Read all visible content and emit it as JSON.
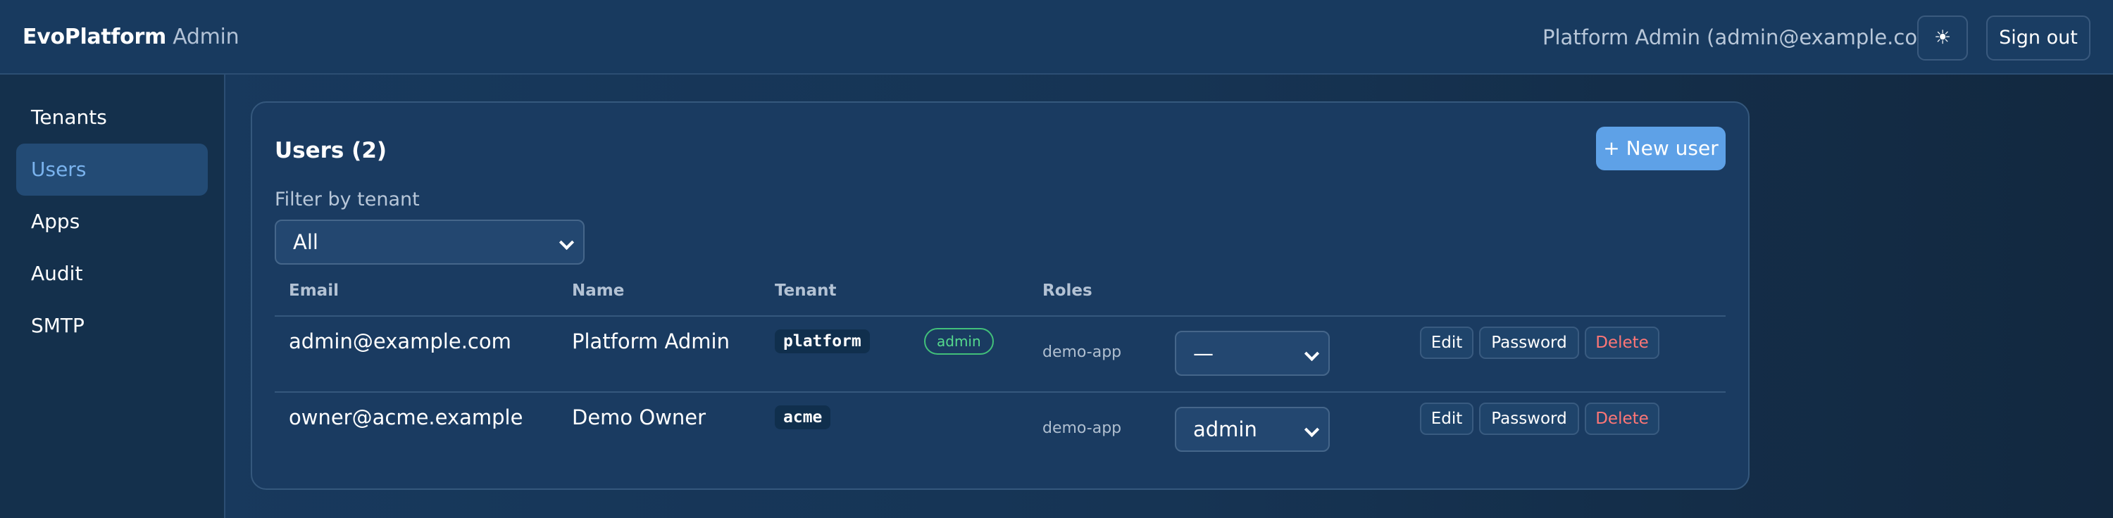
{
  "header": {
    "brand_primary": "EvoPlatform",
    "brand_secondary": "Admin",
    "current_user": "Platform Admin (admin@example.com)",
    "theme_icon": "sun-icon",
    "theme_glyph": "☀",
    "sign_out_label": "Sign out"
  },
  "sidebar": {
    "items": [
      {
        "label": "Tenants",
        "active": false
      },
      {
        "label": "Users",
        "active": true
      },
      {
        "label": "Apps",
        "active": false
      },
      {
        "label": "Audit",
        "active": false
      },
      {
        "label": "SMTP",
        "active": false
      }
    ]
  },
  "main": {
    "title": "Users (2)",
    "new_user_label": "+ New user",
    "filter": {
      "label": "Filter by tenant",
      "selected": "All"
    },
    "table": {
      "columns": [
        "Email",
        "Name",
        "Tenant",
        "Roles"
      ],
      "rows": [
        {
          "email": "admin@example.com",
          "name": "Platform Admin",
          "tenant": "platform",
          "role_badge": "admin",
          "app": "demo-app",
          "role_select": "—",
          "actions": [
            "Edit",
            "Password",
            "Delete"
          ]
        },
        {
          "email": "owner@acme.example",
          "name": "Demo Owner",
          "tenant": "acme",
          "role_badge": "",
          "app": "demo-app",
          "role_select": "admin",
          "actions": [
            "Edit",
            "Password",
            "Delete"
          ]
        }
      ]
    }
  },
  "colors": {
    "accent": "#5ea1e7",
    "active_nav_text": "#7ab3ee",
    "success": "#55d98d",
    "danger": "#ff7676",
    "background": "#183a5f"
  }
}
